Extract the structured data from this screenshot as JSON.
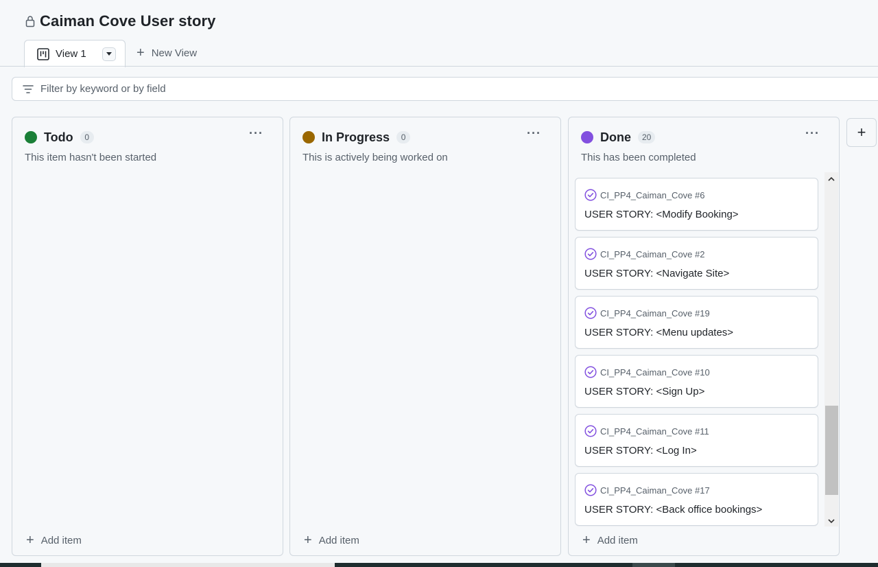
{
  "project": {
    "title": "Caiman Cove User story",
    "icon": "lock-icon"
  },
  "tabs": {
    "active": {
      "label": "View 1",
      "icon": "board-icon"
    },
    "new_view_label": "New View"
  },
  "filter": {
    "placeholder": "Filter by keyword or by field",
    "icon": "filter-icon"
  },
  "colors": {
    "todo": "#1a7f37",
    "in_progress": "#9a6700",
    "done": "#8250df",
    "done_icon": "#8250df"
  },
  "columns": [
    {
      "name": "Todo",
      "count": "0",
      "description": "This item hasn't been started",
      "add_label": "Add item"
    },
    {
      "name": "In Progress",
      "count": "0",
      "description": "This is actively being worked on",
      "add_label": "Add item"
    },
    {
      "name": "Done",
      "count": "20",
      "description": "This has been completed",
      "add_label": "Add item"
    }
  ],
  "done_cards": [
    {
      "ref": "CI_PP4_Caiman_Cove #6",
      "title": "USER STORY: <Modify Booking>"
    },
    {
      "ref": "CI_PP4_Caiman_Cove #2",
      "title": "USER STORY: <Navigate Site>"
    },
    {
      "ref": "CI_PP4_Caiman_Cove #19",
      "title": "USER STORY: <Menu updates>"
    },
    {
      "ref": "CI_PP4_Caiman_Cove #10",
      "title": "USER STORY: <Sign Up>"
    },
    {
      "ref": "CI_PP4_Caiman_Cove #11",
      "title": "USER STORY: <Log In>"
    },
    {
      "ref": "CI_PP4_Caiman_Cove #17",
      "title": "USER STORY: <Back office bookings>"
    }
  ],
  "add_column_label": "+"
}
